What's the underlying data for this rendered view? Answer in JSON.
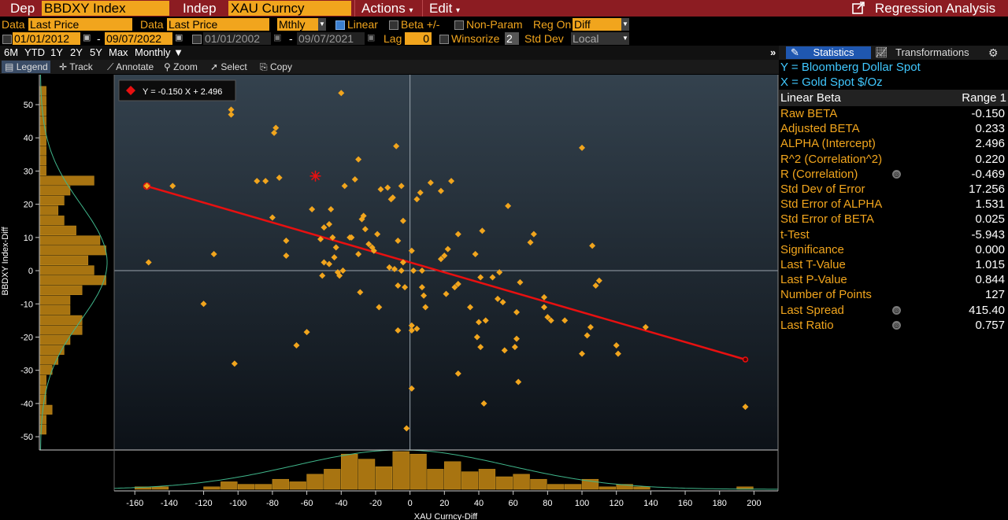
{
  "header": {
    "dep_label": "Dep",
    "dep_value": "BBDXY Index",
    "indep_label": "Indep",
    "indep_value": "XAU Curncy",
    "actions_label": "Actions",
    "edit_label": "Edit",
    "title": "Regression Analysis"
  },
  "options": {
    "data_label_1": "Data",
    "data_value_1": "Last Price",
    "data_label_2": "Data",
    "data_value_2": "Last Price",
    "freq_value": "Mthly",
    "linear_label": "Linear",
    "beta_label": "Beta +/-",
    "nonparam_label": "Non-Param",
    "regon_label": "Reg On",
    "regon_value": "Diff",
    "date1_start": "01/01/2012",
    "date1_end": "09/07/2022",
    "date2_start": "01/01/2002",
    "date2_end": "09/07/2021",
    "dash": "-",
    "lag_label": "Lag",
    "lag_value": "0",
    "winsorize_label": "Winsorize",
    "winsorize_value": "2",
    "stddev_label": "Std Dev",
    "stddev_value": "Local"
  },
  "periods": [
    "6M",
    "YTD",
    "1Y",
    "2Y",
    "5Y",
    "Max"
  ],
  "period_freq": "Monthly",
  "tools": {
    "legend": "Legend",
    "track": "Track",
    "annotate": "Annotate",
    "zoom": "Zoom",
    "select": "Select",
    "copy": "Copy"
  },
  "chart_data": {
    "type": "scatter",
    "equation": "Y = -0.150 X + 2.496",
    "xlabel": "XAU Curncy-Diff",
    "ylabel": "BBDXY Index-Diff",
    "xlim": [
      -172,
      214
    ],
    "ylim": [
      -54,
      59
    ],
    "x_ticks": [
      -160,
      -140,
      -120,
      -100,
      -80,
      -60,
      -40,
      -20,
      0,
      20,
      40,
      60,
      80,
      100,
      120,
      140,
      160,
      180,
      200
    ],
    "y_ticks": [
      50,
      40,
      30,
      20,
      10,
      0,
      -10,
      -20,
      -30,
      -40,
      -50
    ],
    "regression": {
      "slope": -0.15,
      "intercept": 2.496,
      "x_start": -153,
      "x_end": 195
    },
    "last_point": [
      -55,
      28.5
    ],
    "colors": {
      "point": "#f1a51d",
      "line": "#e81010",
      "last": "#e81010"
    },
    "points": [
      [
        -153,
        25.5
      ],
      [
        -138,
        25.5
      ],
      [
        -152,
        2.5
      ],
      [
        -120,
        -10
      ],
      [
        -114,
        5
      ],
      [
        -104,
        48.5
      ],
      [
        -104,
        47
      ],
      [
        -102,
        -28
      ],
      [
        -89,
        27
      ],
      [
        -84,
        27
      ],
      [
        -80,
        16
      ],
      [
        -79,
        41.5
      ],
      [
        -78,
        43
      ],
      [
        -76,
        28
      ],
      [
        -72,
        9
      ],
      [
        -72,
        4.5
      ],
      [
        -66,
        -22.5
      ],
      [
        -60,
        -18.5
      ],
      [
        -57,
        18.5
      ],
      [
        -52,
        9.5
      ],
      [
        -51,
        -1.5
      ],
      [
        -50,
        13
      ],
      [
        -50,
        2.5
      ],
      [
        -47,
        14
      ],
      [
        -47,
        2
      ],
      [
        -46,
        18.5
      ],
      [
        -45,
        10
      ],
      [
        -44,
        4
      ],
      [
        -43,
        7
      ],
      [
        -42,
        -0.5
      ],
      [
        -41,
        -1.5
      ],
      [
        -40,
        53.5
      ],
      [
        -39,
        0
      ],
      [
        -38,
        25.5
      ],
      [
        -35,
        10
      ],
      [
        -34,
        10
      ],
      [
        -32,
        27.5
      ],
      [
        -30,
        33.5
      ],
      [
        -30,
        5
      ],
      [
        -29,
        -6.5
      ],
      [
        -28,
        15.5
      ],
      [
        -27,
        16.5
      ],
      [
        -26,
        12.5
      ],
      [
        -24,
        8
      ],
      [
        -22,
        7
      ],
      [
        -21,
        6
      ],
      [
        -19,
        11
      ],
      [
        -18,
        -11
      ],
      [
        -17,
        24.5
      ],
      [
        -13,
        25
      ],
      [
        -12,
        1
      ],
      [
        -11,
        21.5
      ],
      [
        -10,
        22
      ],
      [
        -9,
        0.5
      ],
      [
        -8,
        37.5
      ],
      [
        -7,
        9
      ],
      [
        -7,
        -4.5
      ],
      [
        -7,
        -18
      ],
      [
        -5,
        25.5
      ],
      [
        -5,
        0
      ],
      [
        -4,
        15
      ],
      [
        -4,
        2.5
      ],
      [
        -3,
        -5
      ],
      [
        -2,
        -47.5
      ],
      [
        1,
        6
      ],
      [
        1,
        -16.5
      ],
      [
        1,
        -18
      ],
      [
        1,
        -35.5
      ],
      [
        2,
        0
      ],
      [
        4,
        21.5
      ],
      [
        4,
        -17.5
      ],
      [
        6,
        23.5
      ],
      [
        7,
        0
      ],
      [
        7,
        -5
      ],
      [
        8,
        -7.5
      ],
      [
        9,
        -11
      ],
      [
        12,
        26.5
      ],
      [
        18,
        24
      ],
      [
        18,
        3.5
      ],
      [
        20,
        4.5
      ],
      [
        21,
        -7
      ],
      [
        22,
        6.5
      ],
      [
        24,
        27
      ],
      [
        26,
        -5
      ],
      [
        28,
        -4
      ],
      [
        28,
        11
      ],
      [
        28,
        -31
      ],
      [
        35,
        -11
      ],
      [
        38,
        5
      ],
      [
        39,
        -20
      ],
      [
        40,
        -15.5
      ],
      [
        41,
        -23
      ],
      [
        41,
        -2
      ],
      [
        42,
        12
      ],
      [
        43,
        -40
      ],
      [
        44,
        -15
      ],
      [
        48,
        -2
      ],
      [
        51,
        -8.5
      ],
      [
        52,
        -0.5
      ],
      [
        54,
        -9.5
      ],
      [
        55,
        -24
      ],
      [
        57,
        19.5
      ],
      [
        61,
        -23
      ],
      [
        62,
        -20.5
      ],
      [
        62,
        -12.5
      ],
      [
        63,
        -33.5
      ],
      [
        64,
        -3.5
      ],
      [
        70,
        8.5
      ],
      [
        72,
        11
      ],
      [
        78,
        -8
      ],
      [
        78,
        -11
      ],
      [
        80,
        -14
      ],
      [
        82,
        -15
      ],
      [
        90,
        -15
      ],
      [
        100,
        37
      ],
      [
        103,
        -19.5
      ],
      [
        106,
        7.5
      ],
      [
        108,
        -4.5
      ],
      [
        110,
        -3
      ],
      [
        120,
        -22.5
      ],
      [
        121,
        -25
      ],
      [
        137,
        -17
      ],
      [
        195,
        -41
      ],
      [
        100,
        -25
      ],
      [
        105,
        -17
      ]
    ],
    "y_hist": {
      "bin_centers": [
        54,
        51,
        48,
        45,
        42,
        39,
        36,
        33,
        30,
        27,
        24,
        21,
        18,
        15,
        12,
        9,
        6,
        3,
        0,
        -3,
        -6,
        -9,
        -12,
        -15,
        -18,
        -21,
        -24,
        -27,
        -30,
        -33,
        -36,
        -39,
        -42,
        -45,
        -48
      ],
      "counts": [
        1,
        1,
        1,
        1,
        1,
        1,
        1,
        1,
        1,
        9,
        5,
        4,
        3,
        4,
        6,
        10,
        11,
        8,
        9,
        11,
        7,
        5,
        5,
        7,
        7,
        5,
        4,
        3,
        2,
        1,
        1,
        1,
        2,
        1,
        1
      ]
    },
    "x_hist": {
      "bin_centers": [
        -155,
        -145,
        -135,
        -125,
        -115,
        -105,
        -95,
        -85,
        -75,
        -65,
        -55,
        -45,
        -35,
        -25,
        -15,
        -5,
        5,
        15,
        25,
        35,
        45,
        55,
        65,
        75,
        85,
        95,
        105,
        115,
        125,
        135,
        145,
        155,
        165,
        175,
        185,
        195
      ],
      "counts": [
        1,
        1,
        0,
        0,
        1,
        3,
        2,
        2,
        4,
        3,
        6,
        8,
        14,
        12,
        9,
        15,
        14,
        8,
        11,
        7,
        8,
        5,
        6,
        4,
        2,
        2,
        4,
        1,
        2,
        1,
        0,
        0,
        0,
        0,
        0,
        1
      ]
    }
  },
  "panel": {
    "tab_statistics": "Statistics",
    "tab_transformations": "Transformations",
    "y_line": "Y = Bloomberg Dollar Spot",
    "x_line": "X = Gold Spot  $/Oz",
    "col_header_left": "Linear Beta",
    "col_header_right": "Range 1",
    "rows": [
      {
        "label": "Raw BETA",
        "value": "-0.150",
        "icon": false
      },
      {
        "label": "Adjusted BETA",
        "value": "0.233",
        "icon": false
      },
      {
        "label": "ALPHA (Intercept)",
        "value": "2.496",
        "icon": false
      },
      {
        "label": "R^2 (Correlation^2)",
        "value": "0.220",
        "icon": false
      },
      {
        "label": "R (Correlation)",
        "value": "-0.469",
        "icon": true
      },
      {
        "label": "Std Dev of Error",
        "value": "17.256",
        "icon": false
      },
      {
        "label": "Std Error of ALPHA",
        "value": "1.531",
        "icon": false
      },
      {
        "label": "Std Error of BETA",
        "value": "0.025",
        "icon": false
      },
      {
        "label": "t-Test",
        "value": "-5.943",
        "icon": false
      },
      {
        "label": "Significance",
        "value": "0.000",
        "icon": false
      },
      {
        "label": "Last T-Value",
        "value": "1.015",
        "icon": false
      },
      {
        "label": "Last P-Value",
        "value": "0.844",
        "icon": false
      },
      {
        "label": "Number of Points",
        "value": "127",
        "icon": false
      },
      {
        "label": "Last Spread",
        "value": "415.40",
        "icon": true
      },
      {
        "label": "Last Ratio",
        "value": "0.757",
        "icon": true
      }
    ]
  }
}
